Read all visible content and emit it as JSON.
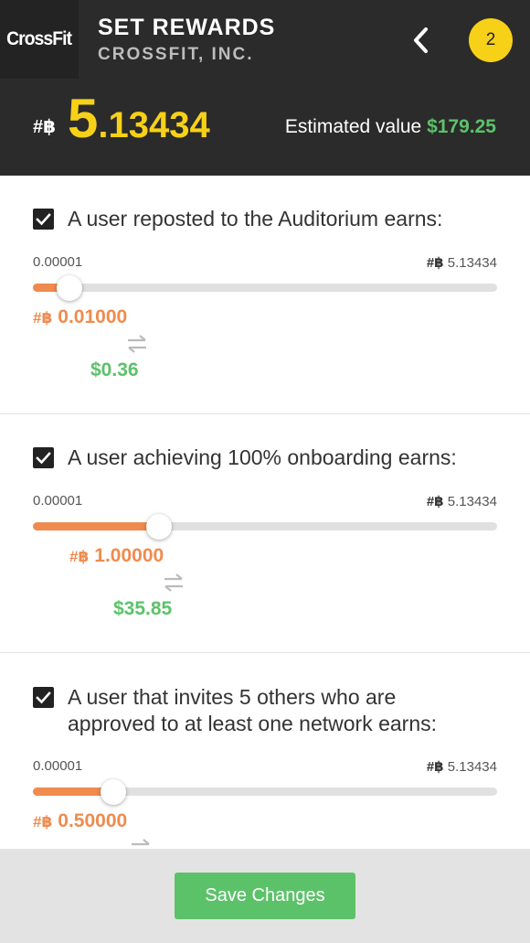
{
  "header": {
    "logo_text": "CrossFit",
    "title": "SET REWARDS",
    "subtitle": "CROSSFIT, INC.",
    "notification_count": "2",
    "token_symbol": "#฿",
    "balance_int": "5",
    "balance_dec": ".13434",
    "estimated_label": "Estimated value",
    "estimated_value": "$179.25"
  },
  "rewards": [
    {
      "checked": true,
      "label": "A user reposted to the Auditorium earns:",
      "min": "0.00001",
      "max_symbol": "#฿",
      "max": "5.13434",
      "amount_symbol": "#฿",
      "amount": "0.01000",
      "usd": "$0.36",
      "level": 0.002
    },
    {
      "checked": true,
      "label": "A user achieving 100% onboarding earns:",
      "min": "0.00001",
      "max_symbol": "#฿",
      "max": "5.13434",
      "amount_symbol": "#฿",
      "amount": "1.00000",
      "usd": "$35.85",
      "level": 0.195
    },
    {
      "checked": true,
      "label_line1": "A user that invites 5 others who are",
      "label_line2": "approved to at least one network earns:",
      "min": "0.00001",
      "max_symbol": "#฿",
      "max": "5.13434",
      "amount_symbol": "#฿",
      "amount": "0.50000",
      "level": 0.097
    }
  ],
  "footer": {
    "save_label": "Save Changes"
  },
  "colors": {
    "header_bg": "#2b2b2b",
    "balance": "#f7d117",
    "reward": "#ef8b4f",
    "usd": "#5cc26a",
    "save_button": "#5cc26a"
  }
}
